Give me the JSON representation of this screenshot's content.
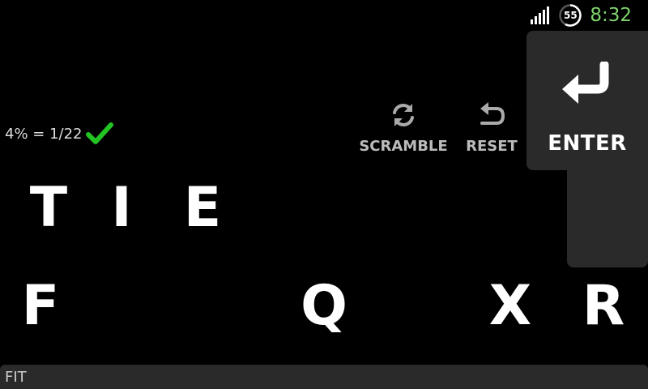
{
  "status_bar": {
    "battery_level": "55",
    "time": "8:32",
    "signal_icon": "signal-icon",
    "battery_icon": "battery-icon"
  },
  "score": {
    "text": "4% = 1/22",
    "icon": "check-icon"
  },
  "actions": {
    "scramble_label": "SCRAMBLE",
    "scramble_icon": "refresh-icon",
    "reset_label": "RESET",
    "reset_icon": "undo-icon"
  },
  "enter": {
    "label": "ENTER",
    "icon": "enter-arrow-icon"
  },
  "tiles": {
    "row1": [
      "T",
      "I",
      "E"
    ],
    "row2": [
      "F",
      "Q",
      "X",
      "R"
    ]
  },
  "current_word": "FIT",
  "colors": {
    "clock": "#7fd36b",
    "check": "#22c322",
    "panel": "#2a2a2a"
  }
}
